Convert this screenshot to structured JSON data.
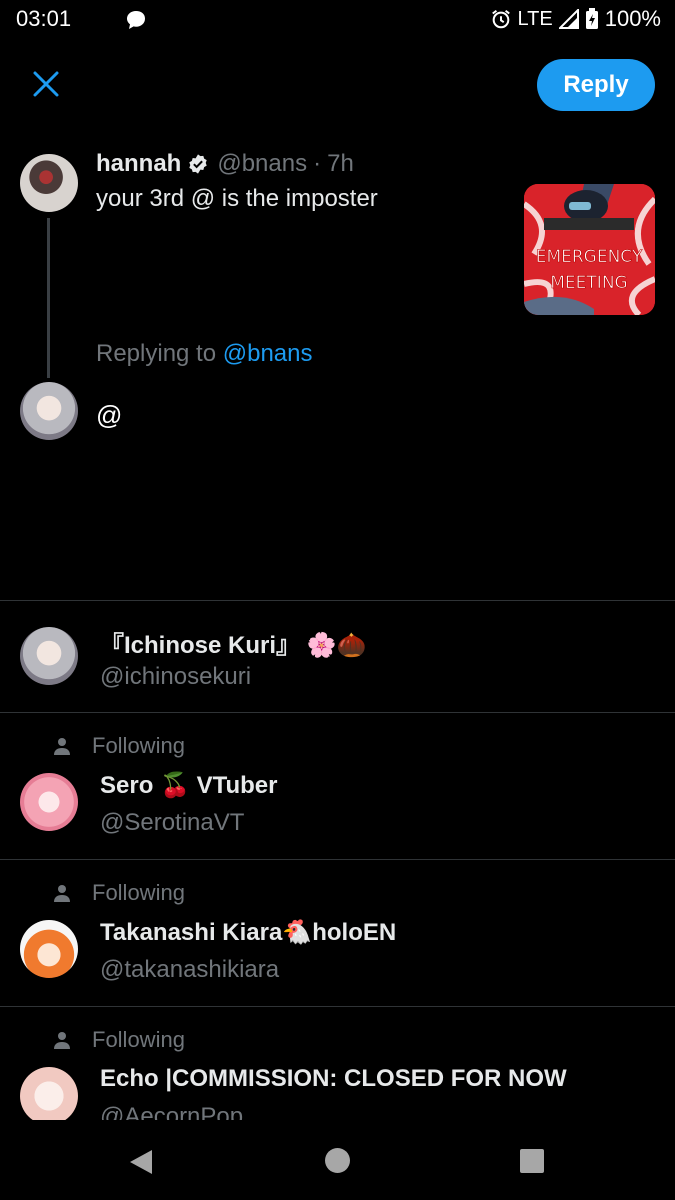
{
  "status_bar": {
    "time": "03:01",
    "network": "LTE",
    "battery": "100%",
    "icons": [
      "message-icon",
      "alarm-icon",
      "signal-icon",
      "battery-icon"
    ]
  },
  "top_bar": {
    "close_icon": "close-icon",
    "reply_label": "Reply"
  },
  "tweet": {
    "name": "hannah",
    "handle": "@bnans",
    "separator": "·",
    "time": "7h",
    "text": "your 3rd @ is the imposter",
    "media_text_line1": "EMERGENCY",
    "media_text_line2": "MEETING"
  },
  "replying": {
    "prefix": "Replying to ",
    "handle": "@bnans"
  },
  "compose": {
    "value": "@"
  },
  "suggestions": [
    {
      "following": "",
      "name": "『Ichinose Kuri』",
      "emoji": "🌸🌰",
      "name_suffix": "",
      "handle": "@ichinosekuri"
    },
    {
      "following": "Following",
      "name": "Sero",
      "emoji": "🍒",
      "name_suffix": " VTuber",
      "handle": "@SerotinaVT"
    },
    {
      "following": "Following",
      "name": "Takanashi Kiara",
      "emoji": "🐔",
      "name_suffix": "holoEN",
      "handle": "@takanashikiara"
    },
    {
      "following": "Following",
      "name": "Echo |COMMISSION: CLOSED FOR NOW",
      "emoji": "",
      "name_suffix": "",
      "handle": "@AecornPop"
    }
  ],
  "colors": {
    "accent": "#1d9bf0",
    "background": "#000000",
    "secondary_text": "#71767b",
    "divider": "#2f3336"
  }
}
